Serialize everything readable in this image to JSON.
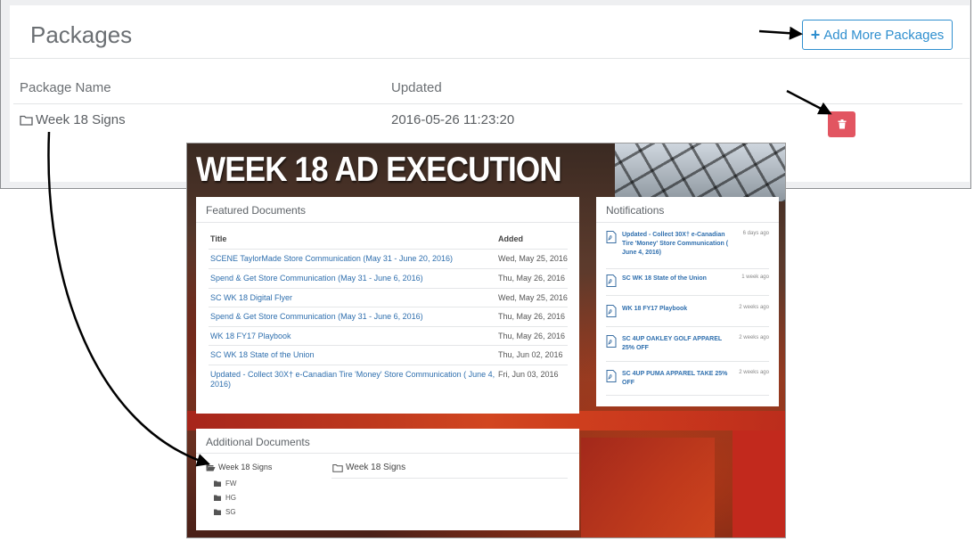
{
  "packages": {
    "title": "Packages",
    "add_button_label": "Add More Packages",
    "columns": [
      "Package Name",
      "Updated"
    ],
    "rows": [
      {
        "name": "Week 18 Signs",
        "updated": "2016-05-26 11:23:20"
      }
    ],
    "accent_color": "#2f8fcf",
    "delete_color": "#e25561"
  },
  "inset": {
    "hero_title": "WEEK 18 AD EXECUTION",
    "featured": {
      "title": "Featured Documents",
      "col_title": "Title",
      "col_added": "Added",
      "rows": [
        {
          "title": "SCENE TaylorMade Store Communication (May 31 - June 20, 2016)",
          "added": "Wed, May 25, 2016"
        },
        {
          "title": "Spend & Get Store Communication (May 31 - June 6, 2016)",
          "added": "Thu, May 26, 2016"
        },
        {
          "title": "SC WK 18 Digital Flyer",
          "added": "Wed, May 25, 2016"
        },
        {
          "title": "Spend & Get Store Communication (May 31 - June 6, 2016)",
          "added": "Thu, May 26, 2016"
        },
        {
          "title": "WK 18 FY17 Playbook",
          "added": "Thu, May 26, 2016"
        },
        {
          "title": "SC WK 18 State of the Union",
          "added": "Thu, Jun 02, 2016"
        },
        {
          "title": "Updated - Collect 30X† e-Canadian Tire 'Money' Store Communication ( June 4, 2016)",
          "added": "Fri, Jun 03, 2016"
        }
      ]
    },
    "notifications": {
      "title": "Notifications",
      "items": [
        {
          "text": "Updated - Collect 30X† e-Canadian Tire 'Money' Store Communication ( June 4, 2016)",
          "time": "6 days ago"
        },
        {
          "text": "SC WK 18 State of the Union",
          "time": "1 week ago"
        },
        {
          "text": "WK 18 FY17 Playbook",
          "time": "2 weeks ago"
        },
        {
          "text": "SC 4UP OAKLEY GOLF APPAREL 25% OFF",
          "time": "2 weeks ago"
        },
        {
          "text": "SC 4UP PUMA APPAREL TAKE 25% OFF",
          "time": "2 weeks ago"
        }
      ]
    },
    "additional": {
      "title": "Additional Documents",
      "folder_open": "Week 18 Signs",
      "subfolders": [
        "FW",
        "HG",
        "SG"
      ],
      "folder_right": "Week 18 Signs"
    }
  }
}
